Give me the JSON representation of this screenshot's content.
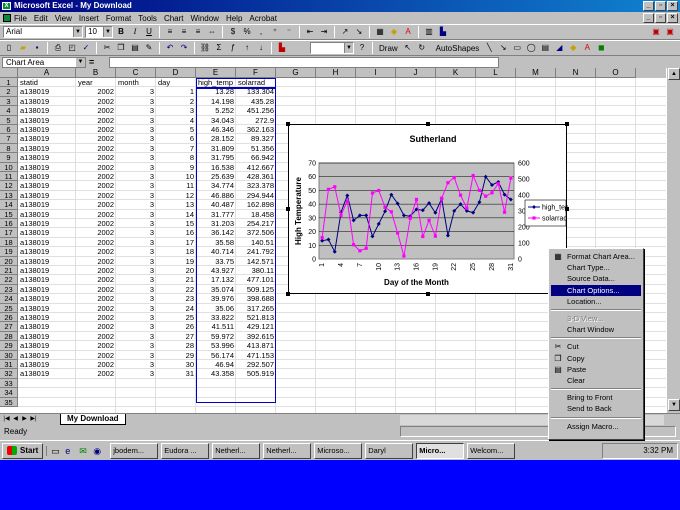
{
  "window": {
    "title": "Microsoft Excel - My Download"
  },
  "menu": {
    "items": [
      "File",
      "Edit",
      "View",
      "Insert",
      "Format",
      "Tools",
      "Chart",
      "Window",
      "Help",
      "Acrobat"
    ]
  },
  "toolbar": {
    "font": "Arial",
    "size": "10",
    "bold": "B",
    "italic": "I",
    "underline": "U",
    "draw": "Draw",
    "autoshapes": "AutoShapes"
  },
  "namebox": {
    "value": "Chart Area"
  },
  "columns": [
    "A",
    "B",
    "C",
    "D",
    "E",
    "F",
    "G",
    "H",
    "I",
    "J",
    "K",
    "L",
    "M",
    "N",
    "O"
  ],
  "header_row": [
    "statid",
    "year",
    "month",
    "day",
    "high_temp",
    "solarrad"
  ],
  "rows": [
    [
      "a138019",
      "2002",
      "3",
      "1",
      "13.28",
      "133.304"
    ],
    [
      "a138019",
      "2002",
      "3",
      "2",
      "14.198",
      "435.28"
    ],
    [
      "a138019",
      "2002",
      "3",
      "3",
      "5.252",
      "451.256"
    ],
    [
      "a138019",
      "2002",
      "3",
      "4",
      "34.043",
      "272.9"
    ],
    [
      "a138019",
      "2002",
      "3",
      "5",
      "46.346",
      "362.163"
    ],
    [
      "a138019",
      "2002",
      "3",
      "6",
      "28.152",
      "89.327"
    ],
    [
      "a138019",
      "2002",
      "3",
      "7",
      "31.809",
      "51.356"
    ],
    [
      "a138019",
      "2002",
      "3",
      "8",
      "31.795",
      "66.942"
    ],
    [
      "a138019",
      "2002",
      "3",
      "9",
      "16.538",
      "412.667"
    ],
    [
      "a138019",
      "2002",
      "3",
      "10",
      "25.639",
      "428.361"
    ],
    [
      "a138019",
      "2002",
      "3",
      "11",
      "34.774",
      "323.378"
    ],
    [
      "a138019",
      "2002",
      "3",
      "12",
      "46.886",
      "294.944"
    ],
    [
      "a138019",
      "2002",
      "3",
      "13",
      "40.487",
      "162.898"
    ],
    [
      "a138019",
      "2002",
      "3",
      "14",
      "31.777",
      "18.458"
    ],
    [
      "a138019",
      "2002",
      "3",
      "15",
      "31.203",
      "254.217"
    ],
    [
      "a138019",
      "2002",
      "3",
      "16",
      "36.142",
      "372.506"
    ],
    [
      "a138019",
      "2002",
      "3",
      "17",
      "35.58",
      "140.51"
    ],
    [
      "a138019",
      "2002",
      "3",
      "18",
      "40.714",
      "241.792"
    ],
    [
      "a138019",
      "2002",
      "3",
      "19",
      "33.75",
      "142.571"
    ],
    [
      "a138019",
      "2002",
      "3",
      "20",
      "43.927",
      "380.11"
    ],
    [
      "a138019",
      "2002",
      "3",
      "21",
      "17.132",
      "477.101"
    ],
    [
      "a138019",
      "2002",
      "3",
      "22",
      "35.074",
      "509.125"
    ],
    [
      "a138019",
      "2002",
      "3",
      "23",
      "39.976",
      "398.688"
    ],
    [
      "a138019",
      "2002",
      "3",
      "24",
      "35.06",
      "317.265"
    ],
    [
      "a138019",
      "2002",
      "3",
      "25",
      "33.822",
      "521.813"
    ],
    [
      "a138019",
      "2002",
      "3",
      "26",
      "41.511",
      "429.121"
    ],
    [
      "a138019",
      "2002",
      "3",
      "27",
      "59.972",
      "392.615"
    ],
    [
      "a138019",
      "2002",
      "3",
      "28",
      "53.996",
      "413.871"
    ],
    [
      "a138019",
      "2002",
      "3",
      "29",
      "56.174",
      "471.153"
    ],
    [
      "a138019",
      "2002",
      "3",
      "30",
      "46.94",
      "292.507"
    ],
    [
      "a138019",
      "2002",
      "3",
      "31",
      "43.358",
      "505.919"
    ]
  ],
  "chart_data": {
    "type": "line",
    "title": "Sutherland",
    "xlabel": "Day of the Month",
    "ylabel": "High Temperature",
    "ylim": [
      0,
      70
    ],
    "y2lim": [
      0,
      600
    ],
    "x": [
      1,
      2,
      3,
      4,
      5,
      6,
      7,
      8,
      9,
      10,
      11,
      12,
      13,
      14,
      15,
      16,
      17,
      18,
      19,
      20,
      21,
      22,
      23,
      24,
      25,
      26,
      27,
      28,
      29,
      30,
      31
    ],
    "xtick_labels": [
      "1",
      "4",
      "7",
      "10",
      "13",
      "16",
      "19",
      "22",
      "25",
      "28",
      "31"
    ],
    "ytick_labels": [
      "0",
      "10",
      "20",
      "30",
      "40",
      "50",
      "60",
      "70"
    ],
    "y2tick_labels": [
      "0",
      "100",
      "200",
      "300",
      "400",
      "500",
      "600"
    ],
    "legend_position": "right",
    "series": [
      {
        "name": "high_temp",
        "axis": "left",
        "color": "#000080",
        "marker": "diamond",
        "values": [
          13.28,
          14.198,
          5.252,
          34.043,
          46.346,
          28.152,
          31.809,
          31.795,
          16.538,
          25.639,
          34.774,
          46.886,
          40.487,
          31.777,
          31.203,
          36.142,
          35.58,
          40.714,
          33.75,
          43.927,
          17.132,
          35.074,
          39.976,
          35.06,
          33.822,
          41.511,
          59.972,
          53.996,
          56.174,
          46.94,
          43.358
        ]
      },
      {
        "name": "solarrad",
        "axis": "right",
        "color": "#ff00ff",
        "marker": "square",
        "values": [
          133.304,
          435.28,
          451.256,
          272.9,
          362.163,
          89.327,
          51.356,
          66.942,
          412.667,
          428.361,
          323.378,
          294.944,
          162.898,
          18.458,
          254.217,
          372.506,
          140.51,
          241.792,
          142.571,
          380.11,
          477.101,
          509.125,
          398.688,
          317.265,
          521.813,
          429.121,
          392.615,
          413.871,
          471.153,
          292.507,
          505.919
        ]
      }
    ]
  },
  "context_menu": {
    "items": [
      {
        "label": "Format Chart Area...",
        "icon": "format-icon",
        "enabled": true
      },
      {
        "label": "Chart Type...",
        "enabled": true
      },
      {
        "label": "Source Data...",
        "enabled": true
      },
      {
        "label": "Chart Options...",
        "enabled": true,
        "selected": true
      },
      {
        "label": "Location...",
        "enabled": true
      },
      {
        "sep": true
      },
      {
        "label": "3-D View...",
        "enabled": false
      },
      {
        "label": "Chart Window",
        "enabled": true
      },
      {
        "sep": true
      },
      {
        "label": "Cut",
        "icon": "scissors-icon",
        "enabled": true
      },
      {
        "label": "Copy",
        "icon": "copy-icon",
        "enabled": true
      },
      {
        "label": "Paste",
        "icon": "paste-icon",
        "enabled": true
      },
      {
        "label": "Clear",
        "enabled": true
      },
      {
        "sep": true
      },
      {
        "label": "Bring to Front",
        "enabled": true
      },
      {
        "label": "Send to Back",
        "enabled": true
      },
      {
        "sep": true
      },
      {
        "label": "Assign Macro...",
        "enabled": true
      }
    ]
  },
  "sheet": {
    "tab": "My Download"
  },
  "status": {
    "text": "Ready"
  },
  "taskbar": {
    "start": "Start",
    "tasks": [
      "jbodem...",
      "Eudora ...",
      "Netherl...",
      "Netherl...",
      "Microso...",
      "Daryl",
      "Micro...",
      "Welcom..."
    ],
    "active_index": 6,
    "clock": "3:32 PM"
  }
}
